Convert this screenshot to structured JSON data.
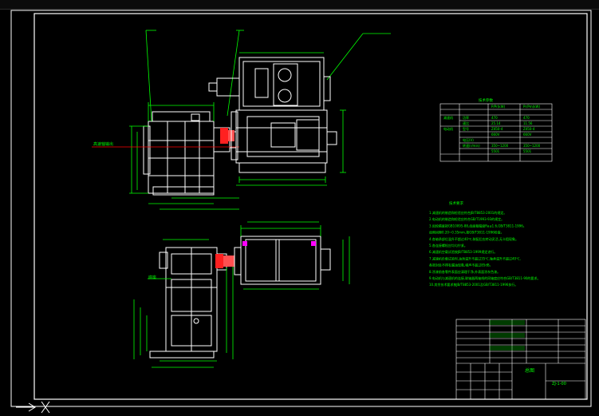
{
  "colors": {
    "background": "#000000",
    "frame": "#ffffff",
    "geometry": "#ffffff",
    "dimensions": "#00ff00",
    "leaders": "#00ff00",
    "accent_red": "#ff2020",
    "axis_red": "#ff0000",
    "table_text": "#00ff00",
    "notes_text": "#00ff00",
    "highlight": "#ff00ff"
  },
  "icons": {
    "ucs": "ucs-axis-icon"
  },
  "labels": {
    "shaft_callout": "高速轴输出",
    "bottom_view_callout": "底座"
  },
  "spec_table": {
    "title": "技术参数",
    "header": [
      "",
      "",
      "P/Pr(kW)",
      "Pr/Pm(kW)"
    ],
    "rows": [
      [
        "减速机",
        "功率",
        "470",
        "470"
      ],
      [
        "",
        "速比",
        "25.14",
        "11.56"
      ],
      [
        "电动机",
        "型号",
        "Z450-4",
        "Z450-4"
      ],
      [
        "",
        "",
        "660V",
        "660V"
      ],
      [
        "",
        "电压(V)",
        "",
        ""
      ],
      [
        "",
        "转速(r/min)",
        "350~1200",
        "350~1200"
      ],
      [
        "",
        "",
        "5501",
        "5501"
      ]
    ]
  },
  "notes": {
    "title": "技术要求",
    "lines": [
      "1.减速机的制造和检验应符合JB/T8853-2001的规定。",
      "2.电动机的制造和检验应符合GB/T1993-93的规定。",
      "3.齿轮精度按GB10095-88,齿面粗糙度Ra≤1.6,GB/T3811-1996。",
      "  齿侧间隙0.20~0.35mm,按GB/T3811-1996检查。",
      "4.各轴承部位温升不超过40℃,装配后应转动灵活,无卡阻现象。",
      "5.各连接螺栓应均匀拧紧。",
      "6.减速机空载试验按JB/T8853-1999规定进行。",
      "7.减速机负载试验时,油池温升不超过35℃,轴承温升不超过40℃,",
      "  各密封处不得有漏油现象,噪声不超过85dB。",
      "8.涂漆前各零件表面应清理干净,外表面涂灰色漆。",
      "9.电动机与减速机的连接,联轴器两轴线的同轴度应符合GB/T3811-90的要求。",
      "10.其余技术要求按JB/T8853-2001及GB/T3811-1996执行。"
    ]
  },
  "title_block": {
    "drawing_name": "总图",
    "drawing_number": "ZJ-1-00",
    "rows": [
      [
        "",
        "",
        "",
        "",
        ""
      ],
      [
        "",
        "",
        "",
        "",
        ""
      ],
      [
        "",
        "",
        "",
        "",
        ""
      ],
      [
        "",
        "",
        "",
        "",
        ""
      ],
      [
        "",
        "",
        "",
        "",
        ""
      ],
      [
        "",
        "",
        "",
        "",
        ""
      ],
      [
        "",
        "",
        "",
        "",
        ""
      ]
    ]
  }
}
